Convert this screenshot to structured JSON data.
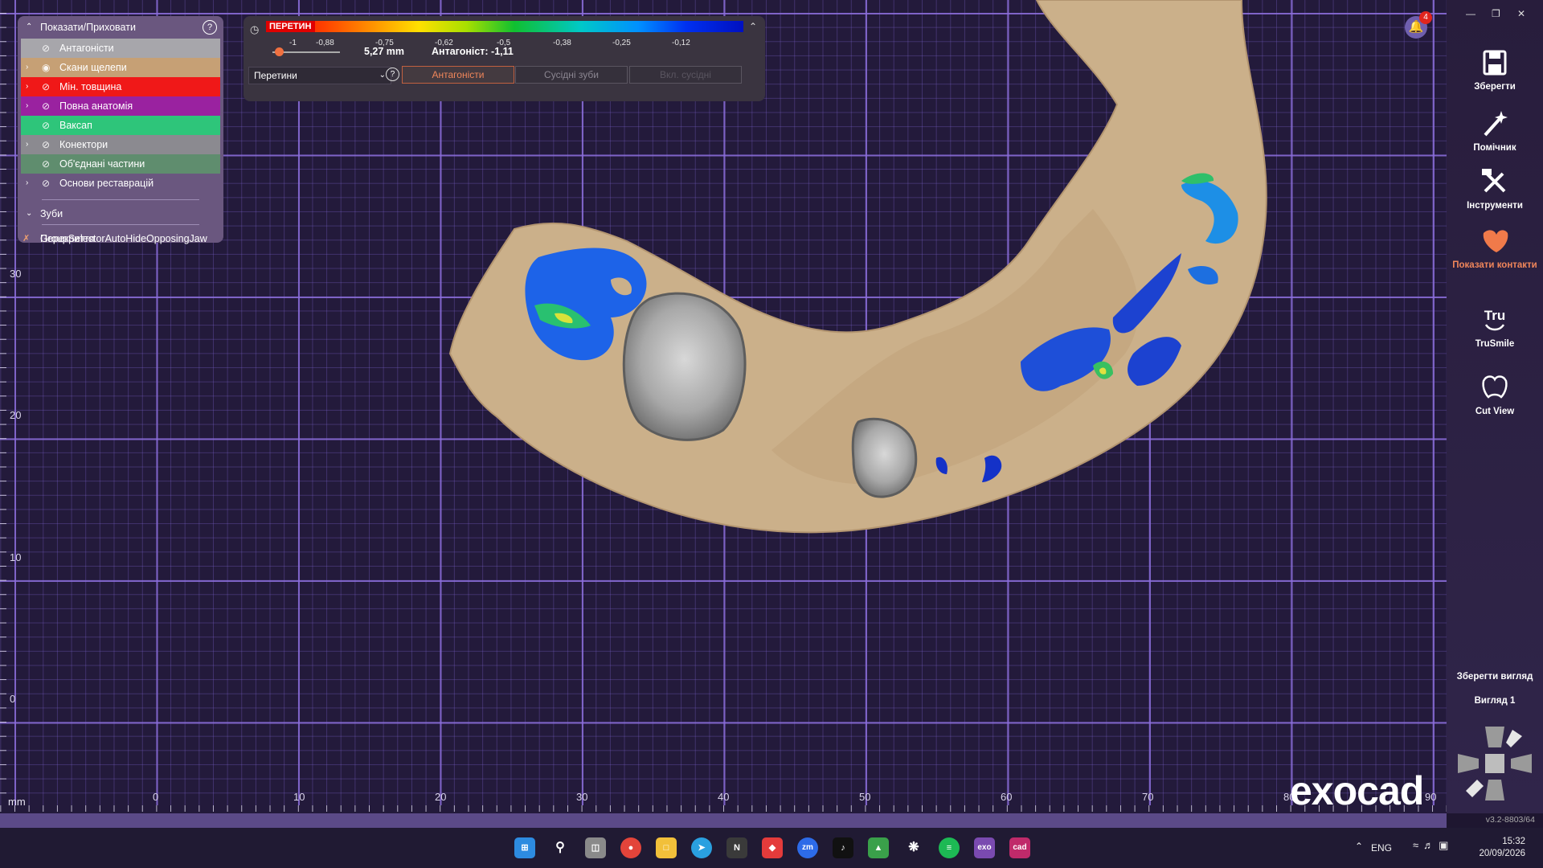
{
  "viewport": {
    "y_ticks": [
      "30",
      "20",
      "10",
      "0"
    ],
    "x_ticks": [
      "0",
      "10",
      "20",
      "30",
      "40",
      "50",
      "60",
      "70",
      "80",
      "90"
    ],
    "unit_label": "mm",
    "brand": "exocad",
    "notification_count": "4"
  },
  "left_panel": {
    "title": "Показати/Приховати",
    "help": "?",
    "rows": [
      {
        "label": "Антагоністи",
        "bg": "#a7a6ab"
      },
      {
        "label": "Скани щелепи",
        "bg": "#c6a075"
      },
      {
        "label": "Мін. товщина",
        "bg": "#f01818"
      },
      {
        "label": "Повна анатомія",
        "bg": "#9a22a0"
      },
      {
        "label": "Ваксап",
        "bg": "#2ec57a"
      },
      {
        "label": "Конектори",
        "bg": "#8b8a90"
      },
      {
        "label": "Об'єднані частини",
        "bg": "#5f8d6e"
      },
      {
        "label": "Основи реставрацій",
        "bg": "#6a577f"
      }
    ],
    "teeth_label": "Зуби",
    "overlap_text_a": "Перекриття",
    "overlap_text_b": "GroupSelectorAutoHideOpposingJaw"
  },
  "top_panel": {
    "scale_label": "ПЕРЕТИН",
    "scale_ticks": [
      "-1",
      "-0,88",
      "-0,75",
      "-0,62",
      "-0,5",
      "-0,38",
      "-0,25",
      "-0,12"
    ],
    "value": "5,27 mm",
    "antagonist": "Антагоніст:  -1,11",
    "select_value": "Перетини",
    "help": "?",
    "btn_antagonists": "Антагоністи",
    "btn_adjacent": "Сусідні зуби",
    "btn_include_adjacent": "Вкл. сусідні",
    "slider_value": 0.1
  },
  "sidebar": {
    "items": [
      {
        "label": "Зберегти",
        "icon": "save-icon"
      },
      {
        "label": "Помічник",
        "icon": "magic-wand-icon"
      },
      {
        "label": "Інструменти",
        "icon": "tools-icon"
      },
      {
        "label": "Показати контакти",
        "icon": "contacts-icon"
      },
      {
        "label": "TruSmile",
        "icon": "trusmile-icon"
      },
      {
        "label": "Cut View",
        "icon": "cut-view-icon"
      }
    ],
    "view_title": "Зберегти вигляд",
    "view_name": "Вигляд 1",
    "version": "v3.2-8803/64"
  },
  "taskbar": {
    "lang": "ENG",
    "time": "15:32",
    "date": "20/09/2026",
    "apps": [
      "windows",
      "search",
      "taskview",
      "chrome",
      "explorer",
      "telegram",
      "notion",
      "anydesk",
      "zoom",
      "tiktok",
      "app",
      "chatgpt",
      "spotify",
      "exo",
      "cad"
    ]
  }
}
